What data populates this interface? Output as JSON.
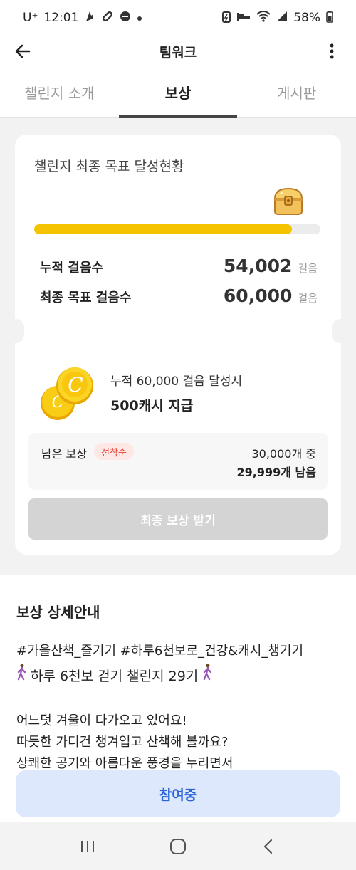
{
  "status_bar": {
    "carrier": "U⁺",
    "time": "12:01",
    "battery": "58%",
    "icons": [
      "notification-app-icon",
      "link-icon",
      "do-not-disturb-icon",
      "dot-icon",
      "battery-saver-icon",
      "sleep-icon",
      "wifi-icon",
      "signal-icon",
      "battery-icon"
    ]
  },
  "app_bar": {
    "title": "팀워크"
  },
  "tabs": [
    {
      "label": "챌린지 소개",
      "active": false
    },
    {
      "label": "보상",
      "active": true
    },
    {
      "label": "게시판",
      "active": false
    }
  ],
  "progress_card": {
    "title": "챌린지 최종 목표 달성현황",
    "progress_fraction": 0.9,
    "stats": [
      {
        "label": "누적 걸음수",
        "value": "54,002",
        "unit": "걸음"
      },
      {
        "label": "최종 목표 걸음수",
        "value": "60,000",
        "unit": "걸음"
      }
    ],
    "reward_condition": "누적 60,000 걸음 달성시",
    "reward_amount": "500캐시 지급",
    "remaining_label": "남은 보상",
    "remaining_badge": "선착순",
    "remaining_total": "30,000개 중",
    "remaining_left": "29,999개 남음",
    "claim_button": "최종 보상 받기"
  },
  "details": {
    "title": "보상 상세안내",
    "hashtags": "#가을산책_즐기기 #하루6천보로_건강&캐시_챙기기",
    "headline": "하루 6천보 걷기 챌린지 29기",
    "lines": [
      "어느덧 겨울이 다가오고 있어요!",
      "따듯한 가디건 챙겨입고 산책해 볼까요?",
      "상쾌한 공기와 아름다운 풍경을 누리면서"
    ]
  },
  "join_button": "참여중",
  "colors": {
    "accent_yellow": "#f5c400",
    "join_blue": "#2a63d6",
    "badge_red": "#e53b2d"
  }
}
